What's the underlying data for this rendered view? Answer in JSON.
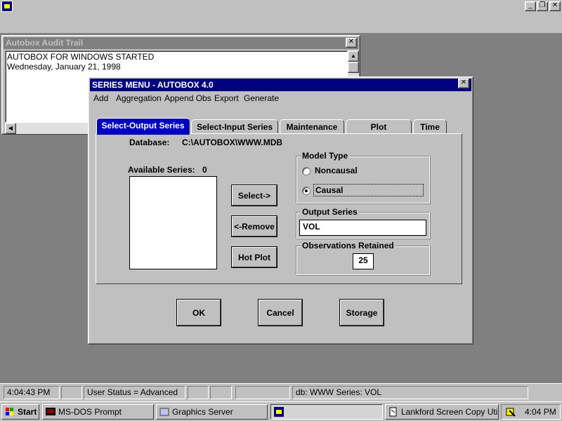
{
  "audit": {
    "title": "Autobox Audit Trail",
    "lines": [
      "AUTOBOX FOR WINDOWS STARTED",
      "Wednesday, January 21, 1998"
    ]
  },
  "dialog": {
    "title": "SERIES MENU - AUTOBOX 4.0",
    "menu": [
      "Add",
      "Aggregation",
      "Append Obs",
      "Export",
      "Generate"
    ],
    "tabs": [
      "Select-Output Series",
      "Select-Input Series",
      "Maintenance",
      "Plot",
      "Time"
    ],
    "active_tab": 0,
    "database_label": "Database:",
    "database_path": "C:\\AUTOBOX\\WWW.MDB",
    "available_label": "Available Series:",
    "available_count": "0",
    "buttons": {
      "select": "Select->",
      "remove": "<-Remove",
      "hot_plot": "Hot Plot"
    },
    "model_type": {
      "label": "Model Type",
      "options": [
        "Noncausal",
        "Causal"
      ],
      "selected": "Causal"
    },
    "output_series": {
      "label": "Output Series",
      "value": "VOL"
    },
    "observations": {
      "label": "Observations Retained",
      "value": "25"
    },
    "footer_buttons": {
      "ok": "OK",
      "cancel": "Cancel",
      "storage": "Storage"
    }
  },
  "statusbar": {
    "time": "4:04:43 PM",
    "user_status": "User Status = Advanced",
    "db_info": "db: WWW Series: VOL"
  },
  "taskbar": {
    "start": "Start",
    "tasks": [
      "MS-DOS Prompt",
      "Graphics Server",
      "",
      "Lankford Screen Copy Utility"
    ],
    "clock": "4:04 PM"
  },
  "colors": {
    "title_active": "#000080",
    "tab_active": "#0000c0",
    "face": "#c0c0c0",
    "desktop": "#808080"
  }
}
